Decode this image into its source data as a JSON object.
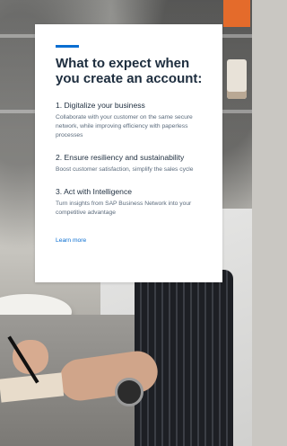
{
  "card": {
    "title": "What to expect when you create an account:",
    "accent_color": "#0a6ed1",
    "items": [
      {
        "heading": "1. Digitalize your business",
        "description": "Collaborate with your customer on the same secure network, while improving efficiency with paperless processes"
      },
      {
        "heading": "2. Ensure resiliency and sustainability",
        "description": "Boost customer satisfaction, simplify the sales cycle"
      },
      {
        "heading": "3. Act with Intelligence",
        "description": "Turn insights from SAP Business Network into your competitive advantage"
      }
    ],
    "link_label": "Learn more"
  }
}
